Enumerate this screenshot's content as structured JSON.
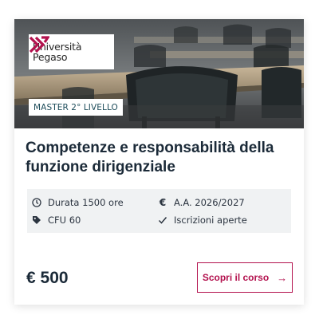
{
  "card": {
    "brand": {
      "line1": "Università",
      "line2": "Pegaso",
      "accent_color": "#b3124e"
    },
    "level_badge": "MASTER 2° LIVELLO",
    "title": "Competenze e responsabilità della funzione dirigenziale",
    "info": {
      "duration": {
        "icon": "clock-icon",
        "text": "Durata 1500 ore"
      },
      "credits": {
        "icon": "tag-icon",
        "text": "CFU 60"
      },
      "academic_year": {
        "icon": "euro-icon",
        "text": "A.A. 2026/2027"
      },
      "status": {
        "icon": "check-icon",
        "text": "Iscrizioni aperte"
      }
    },
    "price": "€ 500",
    "cta": {
      "label": "Scopri il corso",
      "icon": "arrow-right-icon"
    }
  }
}
